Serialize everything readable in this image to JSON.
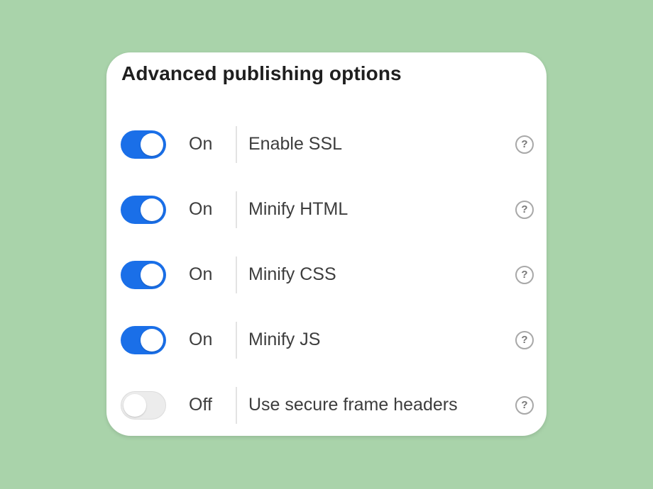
{
  "panel": {
    "title": "Advanced publishing options"
  },
  "options": [
    {
      "state_label": "On",
      "enabled": true,
      "label": "Enable SSL",
      "help_icon": "question-circle-icon",
      "help_glyph": "?"
    },
    {
      "state_label": "On",
      "enabled": true,
      "label": "Minify HTML",
      "help_icon": "question-circle-icon",
      "help_glyph": "?"
    },
    {
      "state_label": "On",
      "enabled": true,
      "label": "Minify CSS",
      "help_icon": "question-circle-icon",
      "help_glyph": "?"
    },
    {
      "state_label": "On",
      "enabled": true,
      "label": "Minify JS",
      "help_icon": "question-circle-icon",
      "help_glyph": "?"
    },
    {
      "state_label": "Off",
      "enabled": false,
      "label": "Use secure frame headers",
      "help_icon": "question-circle-icon",
      "help_glyph": "?"
    }
  ],
  "colors": {
    "background": "#a9d3aa",
    "toggle_on": "#1a6fe8",
    "toggle_off": "#ececec",
    "text": "#3d3d3d"
  }
}
